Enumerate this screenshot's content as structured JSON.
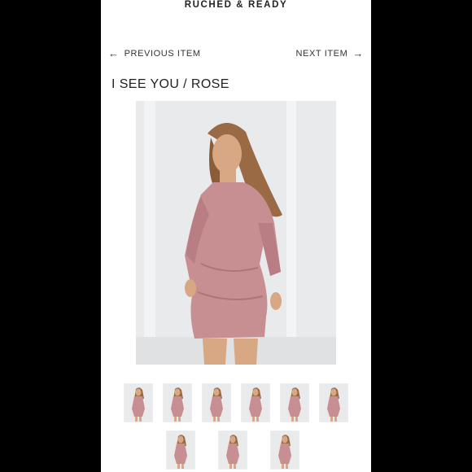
{
  "header": {
    "brand": "RUCHED & READY"
  },
  "nav": {
    "previous_label": "PREVIOUS ITEM",
    "next_label": "NEXT ITEM"
  },
  "product": {
    "title": "I SEE YOU / ROSE"
  },
  "colors": {
    "dress": "#c88f93",
    "background": "#e9eaec",
    "skin": "#d8a885",
    "hair": "#9a6a44"
  },
  "icons": {
    "previous": "arrow-left-icon",
    "next": "arrow-right-icon"
  },
  "thumbnails_row1": [
    "thumb-1",
    "thumb-2",
    "thumb-3",
    "thumb-4",
    "thumb-5",
    "thumb-6"
  ],
  "thumbnails_row2": [
    "thumb-7",
    "thumb-8",
    "thumb-9"
  ]
}
